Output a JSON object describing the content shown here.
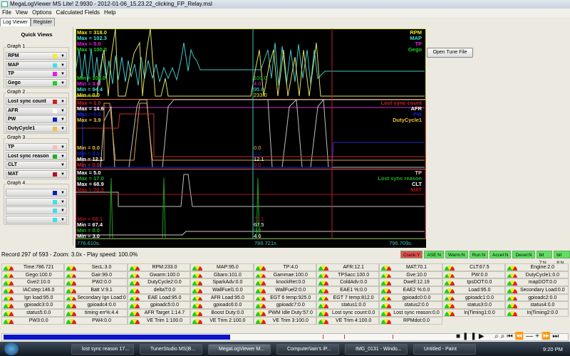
{
  "window": {
    "title": "MegaLogViewer MS Lite! 2.9930 - 2012-01-06_15.23.22_clicking_FP_Relay.msl"
  },
  "menu": [
    "File",
    "View",
    "Options",
    "Calculated Fields",
    "Help"
  ],
  "tabs": [
    "Log Viewer",
    "Register"
  ],
  "quick_views": {
    "title": "Quick Views",
    "groups": [
      {
        "label": "Graph 1",
        "items": [
          {
            "name": "RPM",
            "color": "#f0f020"
          },
          {
            "name": "MAP",
            "color": "#40e0e0"
          },
          {
            "name": "TP",
            "color": "#e020e0"
          },
          {
            "name": "Gego",
            "color": "#20d020"
          }
        ]
      },
      {
        "label": "Graph 2",
        "items": [
          {
            "name": "Lost sync count",
            "color": "#d02020"
          },
          {
            "name": "AFR",
            "color": "#ffffff"
          },
          {
            "name": "PW",
            "color": "#1020c0"
          },
          {
            "name": "DutyCycle1",
            "color": "#f0c040"
          }
        ]
      },
      {
        "label": "Graph 3",
        "items": [
          {
            "name": "TP",
            "color": "#f0c0c0"
          },
          {
            "name": "Lost sync reason",
            "color": "#20b020"
          },
          {
            "name": "CLT",
            "color": ""
          },
          {
            "name": "MAT",
            "color": "#b01020"
          }
        ]
      },
      {
        "label": "Graph 4",
        "items": [
          {
            "name": "",
            "color": "#1020b0"
          },
          {
            "name": "",
            "color": "#40e0e0"
          },
          {
            "name": "",
            "color": "#40e0e0"
          },
          {
            "name": "",
            "color": "#40e0e0"
          }
        ]
      }
    ]
  },
  "graphs": [
    {
      "max": [
        {
          "t": "Max = 318.0",
          "c": "#f0f020"
        },
        {
          "t": "Max = 102.3",
          "c": "#40e0e0"
        },
        {
          "t": "Max = 5.0",
          "c": "#e020e0"
        },
        {
          "t": "Max = 100.0",
          "c": "#20d020"
        }
      ],
      "min": [
        {
          "t": "Min = 100.0",
          "c": "#20d020"
        },
        {
          "t": "Min = 3.0",
          "c": "#e020e0"
        },
        {
          "t": "Min = 94.4",
          "c": "#40e0e0"
        },
        {
          "t": "Min = 0.0",
          "c": "#f0f020"
        }
      ],
      "cursor": [
        {
          "t": "100.0",
          "c": "#20d020"
        },
        {
          "t": "4.0",
          "c": "#e020e0"
        },
        {
          "t": "95.0",
          "c": "#40e0e0"
        },
        {
          "t": "233.0",
          "c": "#f0f020"
        }
      ],
      "legend": [
        {
          "t": "RPM",
          "c": "#f0f020"
        },
        {
          "t": "MAP",
          "c": "#40e0e0"
        },
        {
          "t": "TP",
          "c": "#e020e0"
        },
        {
          "t": "Gego",
          "c": "#20d020"
        }
      ]
    },
    {
      "max": [
        {
          "t": "Max = 1.0",
          "c": "#d02020"
        },
        {
          "t": "Max = 14.6",
          "c": "#ffffff"
        },
        {
          "t": "Max = 0.0",
          "c": "#1020c0"
        },
        {
          "t": "Max = 3.9",
          "c": "#f0c040"
        }
      ],
      "min": [
        {
          "t": "Min = 0.0",
          "c": "#f0c040"
        },
        {
          "t": "Min = 0.0",
          "c": "#1020c0"
        },
        {
          "t": "Min = 12.1",
          "c": "#ffffff"
        },
        {
          "t": "Min = 0.0",
          "c": "#d02020"
        }
      ],
      "cursor": [
        {
          "t": "0.0",
          "c": "#f0c040"
        },
        {
          "t": "0.0",
          "c": "#1020c0"
        },
        {
          "t": "12.1",
          "c": "#ffffff"
        },
        {
          "t": "0.0",
          "c": "#d02020"
        }
      ],
      "legend": [
        {
          "t": "Lost sync count",
          "c": "#d02020"
        },
        {
          "t": "AFR",
          "c": "#ffffff"
        },
        {
          "t": "PW",
          "c": "#1020c0"
        },
        {
          "t": "DutyCycle1",
          "c": "#f0c040"
        }
      ]
    },
    {
      "max": [
        {
          "t": "Max = 5.0",
          "c": "#ffffff"
        },
        {
          "t": "Max = 17.0",
          "c": "#20b020"
        },
        {
          "t": "Max = 68.9",
          "c": "#ffffff"
        },
        {
          "t": "Max = 70.3",
          "c": "#b01020"
        }
      ],
      "min": [
        {
          "t": "Min = 69.1",
          "c": "#b01020"
        },
        {
          "t": "Min = 67.4",
          "c": "#ffffff"
        },
        {
          "t": "Min = 0.0",
          "c": "#20b020"
        },
        {
          "t": "Min = 3.0",
          "c": "#ffffff"
        }
      ],
      "cursor": [
        {
          "t": "70.1",
          "c": "#b01020"
        },
        {
          "t": "67.5",
          "c": "#ffffff"
        },
        {
          "t": "0.0",
          "c": "#20b020"
        },
        {
          "t": "4.0",
          "c": "#ffffff"
        }
      ],
      "legend": [
        {
          "t": "TP",
          "c": "#f0c0c0"
        },
        {
          "t": "Lost sync reason",
          "c": "#20b020"
        },
        {
          "t": "CLT",
          "c": "#ffffff"
        },
        {
          "t": "MAT",
          "c": "#b01020"
        }
      ]
    }
  ],
  "timeline": {
    "start": "776.610s.",
    "cursor": "786.721s",
    "end": "796.709s."
  },
  "open_tune_label": "Open Tune File",
  "status": "Record 297 of 593 - Zoom: 3.0x - Play speed: 100.0%",
  "indicators": [
    {
      "t": "Crank:Y",
      "c": "#e85050"
    },
    {
      "t": "ASE:N",
      "c": "#60e060"
    },
    {
      "t": "Warm:N",
      "c": "#60e060"
    },
    {
      "t": "Run:N",
      "c": "#60e060"
    },
    {
      "t": "Accel:N",
      "c": "#60e060"
    },
    {
      "t": "Decel:N",
      "c": "#60e060"
    },
    {
      "t": "bit 7:N",
      "c": "#60e060"
    },
    {
      "t": "bit 8:N",
      "c": "#60e060"
    }
  ],
  "gauges": [
    "Time:786.721",
    "SecL:3.0",
    "RPM:233.0",
    "MAP:95.0",
    "TP:4.0",
    "AFR:12.1",
    "MAT:70.1",
    "CLT:67.5",
    "Engine:2.0",
    "Gego:100.0",
    "Gair:99.0",
    "Gwarm:100.0",
    "Gbaro:101.0",
    "Gammae:100.0",
    "TPSacc:100.0",
    "Gve:10.0",
    "PW:0.0",
    "DutyCycle1:0.0",
    "Gve2:10.0",
    "PW2:0.0",
    "DutyCycle2:0.0",
    "SparkAdv:0.0",
    "knockRet:0.0",
    "ColdAdv:0.0",
    "Dwell:12.19",
    "tpsDOT:0.0",
    "mapDOT:0.0",
    "IACstep:146.0",
    "Batt V:9.1",
    "deltaT:0.0",
    "WallFuel1:0.0",
    "WallFuel2:0.0",
    "EAE1 %:0.0",
    "EAE2 %:0.0",
    "Load:95.0",
    "Secondary Load:0.0",
    "Ign load:95.0",
    "Secondary Ign Load:0",
    "EAE Load:95.0",
    "AFR Load:95.0",
    "EGT 6 temp:925.0",
    "EGT 7 temp:812.0",
    "gpioadc0:0.0",
    "gpioadc1:0.0",
    "gpioadc2:0.0",
    "gpioadc3:0.0",
    "gpioadc4:0.0",
    "gpioadc5:0.0",
    "gpioadc6:0.0",
    "gpioadc7:0.0",
    "status1:0.0",
    "status2:0.0",
    "status3:0.0",
    "status4:0.0",
    "status5:0.0",
    "timing err%:4.4",
    "AFR Target 1:14.7",
    "Boost Duty:0.0",
    "PWM Idle Duty:57.0",
    "Lost sync count:0.0",
    "Lost sync reason:0.0",
    "InjTiming1:0.0",
    "InjTiming2:0.0",
    "PW3:0.0",
    "PW4:0.0",
    "VE Trim 1:100.0",
    "VE Trim 2:100.0",
    "VE Trim 3:100.0",
    "VE Trim 4:100.0",
    "RPMdot:0.0"
  ],
  "playback": {
    "position_percent": 40
  },
  "taskbar": {
    "items": [
      "lost sync reason 17...",
      "TunerStudio MS(B...",
      "MegaLogViewer M...",
      "Computer\\iain's iP...",
      "IMG_0131 - Windo...",
      "Untitled - Paint"
    ],
    "active": 2,
    "clock": "9:20 PM"
  }
}
